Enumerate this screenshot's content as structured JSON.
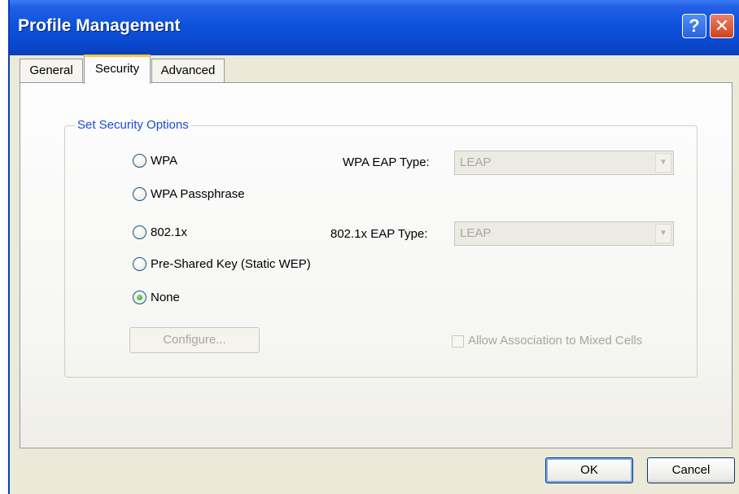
{
  "window": {
    "title": "Profile Management"
  },
  "titlebar": {
    "help_label": "?",
    "close_label": "✕"
  },
  "tabs": [
    {
      "label": "General",
      "selected": false
    },
    {
      "label": "Security",
      "selected": true
    },
    {
      "label": "Advanced",
      "selected": false
    }
  ],
  "security": {
    "group_label": "Set Security Options",
    "options": [
      {
        "label": "WPA",
        "checked": false
      },
      {
        "label": "WPA Passphrase",
        "checked": false
      },
      {
        "label": "802.1x",
        "checked": false
      },
      {
        "label": "Pre-Shared Key (Static WEP)",
        "checked": false
      },
      {
        "label": "None",
        "checked": true
      }
    ],
    "wpa_eap": {
      "label": "WPA EAP Type:",
      "value": "LEAP",
      "enabled": false
    },
    "dot1x_eap": {
      "label": "802.1x EAP Type:",
      "value": "LEAP",
      "enabled": false
    },
    "configure_label": "Configure...",
    "mixed_cells": {
      "label": "Allow Association to Mixed Cells",
      "checked": false,
      "enabled": false
    }
  },
  "buttons": {
    "ok": "OK",
    "cancel": "Cancel"
  },
  "icons": {
    "help": "help-icon",
    "close": "close-icon",
    "dropdown": "chevron-down-icon"
  },
  "colors": {
    "titlebar": "#0a48cf",
    "group_label": "#1a4ad8",
    "selected_tab_accent": "#ffc83c",
    "radio_selected": "#21a121",
    "disabled_text": "#a8a79b"
  }
}
